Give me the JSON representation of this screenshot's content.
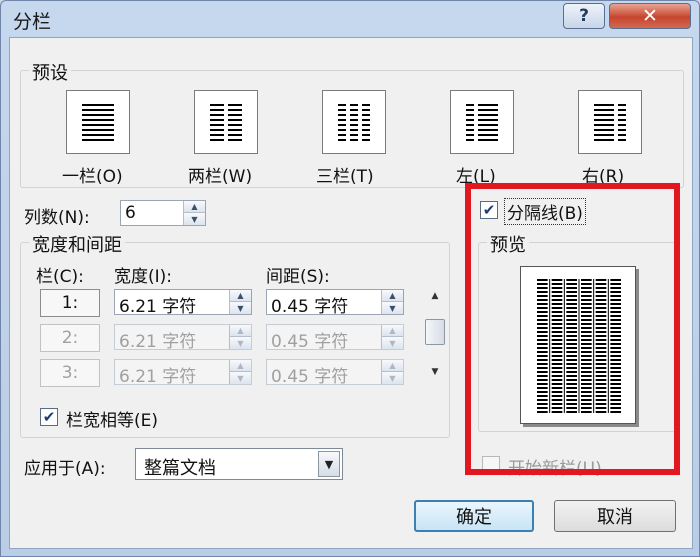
{
  "window": {
    "title": "分栏",
    "help_label": "?",
    "close_label": "✕"
  },
  "presets": {
    "group_title": "预设",
    "items": [
      {
        "label": "一栏(O)",
        "icon": "one-column-icon"
      },
      {
        "label": "两栏(W)",
        "icon": "two-columns-icon"
      },
      {
        "label": "三栏(T)",
        "icon": "three-columns-icon"
      },
      {
        "label": "左(L)",
        "icon": "left-column-icon"
      },
      {
        "label": "右(R)",
        "icon": "right-column-icon"
      }
    ]
  },
  "columns_count": {
    "label": "列数(N):",
    "value": "6"
  },
  "width_spacing": {
    "group_title": "宽度和间距",
    "header_col": "栏(C):",
    "header_width": "宽度(I):",
    "header_spacing": "间距(S):",
    "rows": [
      {
        "num": "1:",
        "width": "6.21 字符",
        "spacing": "0.45 字符",
        "enabled": true
      },
      {
        "num": "2:",
        "width": "6.21 字符",
        "spacing": "0.45 字符",
        "enabled": false
      },
      {
        "num": "3:",
        "width": "6.21 字符",
        "spacing": "0.45 字符",
        "enabled": false
      }
    ]
  },
  "equal_width": {
    "label": "栏宽相等(E)",
    "checked": true
  },
  "apply_to": {
    "label": "应用于(A):",
    "value": "整篇文档"
  },
  "line_between": {
    "label": "分隔线(B)",
    "checked": true
  },
  "preview": {
    "title": "预览",
    "columns": 6
  },
  "start_new_column": {
    "label": "开始新栏(U)",
    "checked": false,
    "enabled": false
  },
  "buttons": {
    "ok": "确定",
    "cancel": "取消"
  },
  "colors": {
    "highlight": "#e3171f",
    "checkmark": "#1d3d7a"
  }
}
